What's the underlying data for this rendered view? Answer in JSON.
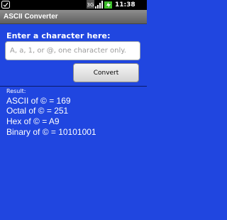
{
  "status_bar": {
    "network": "3G",
    "time": "11:38 PM"
  },
  "title_bar": {
    "title": "ASCII Converter"
  },
  "form": {
    "prompt": "Enter a character here:",
    "input_value": "",
    "input_placeholder": "A, a, 1, or @, one character only.",
    "convert_label": "Convert"
  },
  "result": {
    "label": "Result:",
    "lines": [
      "ASCII of © = 169",
      "Octal of © = 251",
      "Hex of © = A9",
      "Binary of © = 10101001"
    ]
  }
}
